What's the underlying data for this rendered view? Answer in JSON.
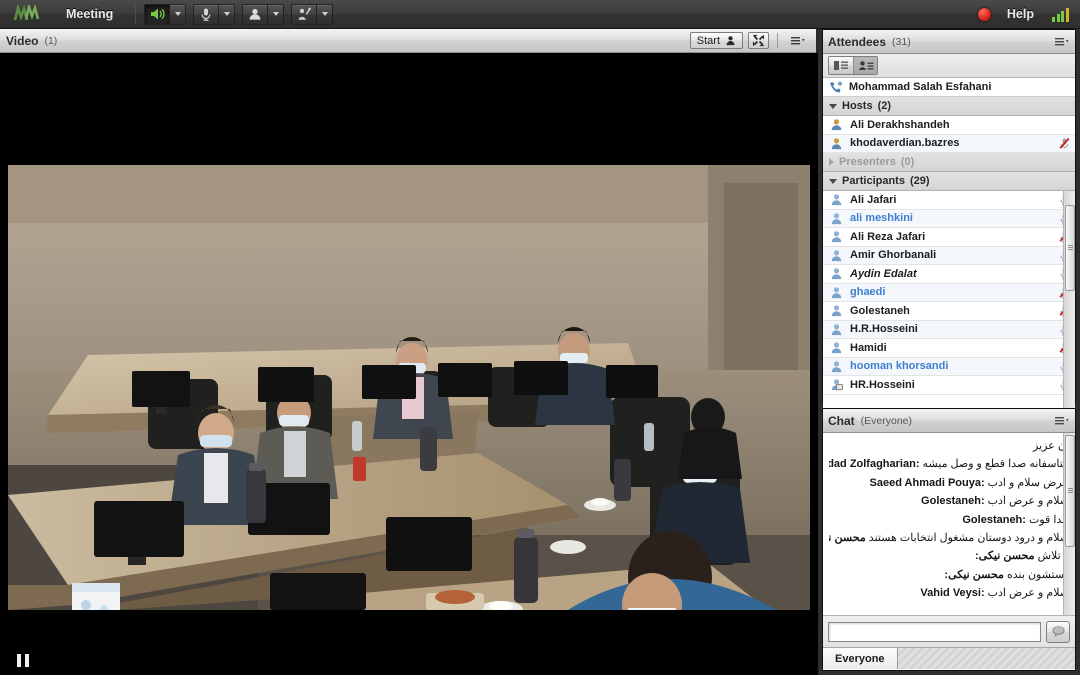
{
  "topbar": {
    "logo": "M",
    "menu_label": "Meeting",
    "controls": [
      {
        "name": "speaker",
        "icon": "speaker-icon",
        "active": true
      },
      {
        "name": "microphone",
        "icon": "microphone-icon",
        "active": false
      },
      {
        "name": "camera",
        "icon": "camera-icon",
        "active": false
      },
      {
        "name": "raise-hand",
        "icon": "raise-hand-icon",
        "active": false
      }
    ],
    "record_label": "",
    "help_label": "Help",
    "signal_icon": "signal-strength-icon"
  },
  "video_pod": {
    "title": "Video",
    "count": "(1)",
    "start_label": "Start",
    "start_icon": "person-icon",
    "fullscreen_icon": "fullscreen-icon",
    "menu_icon": "pod-menu-icon",
    "pause_icon": "pause-icon"
  },
  "attendees": {
    "title": "Attendees",
    "count": "(31)",
    "menu_icon": "panel-menu-icon",
    "view_buttons": [
      {
        "name": "list-view-button",
        "icon": "list-view-icon",
        "selected": false
      },
      {
        "name": "card-view-button",
        "icon": "card-view-icon",
        "selected": true
      }
    ],
    "self": {
      "name": "Mohammad Salah Esfahani",
      "icon": "phone-attendee-icon"
    },
    "groups": [
      {
        "label": "Hosts",
        "count": "(2)",
        "expanded": true
      },
      {
        "label": "Presenters",
        "count": "(0)",
        "expanded": false
      },
      {
        "label": "Participants",
        "count": "(29)",
        "expanded": true
      }
    ],
    "hosts": [
      {
        "name": "Ali Derakhshandeh",
        "icon": "host-icon",
        "mic": "none",
        "highlight": false
      },
      {
        "name": "khodaverdian.bazres",
        "icon": "host-icon",
        "mic": "muted",
        "highlight": false
      }
    ],
    "participants": [
      {
        "name": "Ali Jafari",
        "icon": "attendee-icon",
        "mic": "on",
        "highlight": false,
        "italic": false
      },
      {
        "name": "ali meshkini",
        "icon": "attendee-icon",
        "mic": "on",
        "highlight": true,
        "italic": false
      },
      {
        "name": "Ali Reza Jafari",
        "icon": "attendee-icon",
        "mic": "muted",
        "highlight": false,
        "italic": false
      },
      {
        "name": "Amir Ghorbanali",
        "icon": "attendee-icon",
        "mic": "on",
        "highlight": false,
        "italic": false
      },
      {
        "name": "Aydin Edalat",
        "icon": "attendee-icon",
        "mic": "on",
        "highlight": false,
        "italic": true
      },
      {
        "name": "ghaedi",
        "icon": "attendee-icon",
        "mic": "muted",
        "highlight": true,
        "italic": false
      },
      {
        "name": "Golestaneh",
        "icon": "attendee-icon",
        "mic": "muted",
        "highlight": false,
        "italic": false
      },
      {
        "name": "H.R.Hosseini",
        "icon": "attendee-icon",
        "mic": "on",
        "highlight": false,
        "italic": false
      },
      {
        "name": "Hamidi",
        "icon": "attendee-icon",
        "mic": "muted",
        "highlight": false,
        "italic": false
      },
      {
        "name": "hooman khorsandi",
        "icon": "attendee-icon",
        "mic": "on",
        "highlight": true,
        "italic": false
      },
      {
        "name": "HR.Hosseini",
        "icon": "attendee-presenting-icon",
        "mic": "on",
        "highlight": false,
        "italic": false
      }
    ]
  },
  "chat": {
    "title": "Chat",
    "scope": "(Everyone)",
    "menu_icon": "panel-menu-icon",
    "messages": [
      {
        "sender": "",
        "sender_dir": "rtl",
        "text": "ان عزیز"
      },
      {
        "sender": "Mehrdad Zolfagharian:",
        "sender_dir": "ltr",
        "text": "متاسفانه صدا قطع و وصل میشه"
      },
      {
        "sender": "Saeed Ahmadi Pouya:",
        "sender_dir": "ltr",
        "text": "عرض سلام و ادب"
      },
      {
        "sender": "Golestaneh:",
        "sender_dir": "ltr",
        "text": "سلام و عرض ادب"
      },
      {
        "sender": "Golestaneh:",
        "sender_dir": "ltr",
        "text": "خدا قوت"
      },
      {
        "sender": "محسن نیکی:",
        "sender_dir": "rtl",
        "text": "سلام و درود  دوستان مشغول انتخابات هستند"
      },
      {
        "sender": "محسن نیکی:",
        "sender_dir": "rtl",
        "text": "و تلاش"
      },
      {
        "sender": "محسن نیکی:",
        "sender_dir": "rtl",
        "text": "دستشون بنده"
      },
      {
        "sender": "Vahid Veysi:",
        "sender_dir": "ltr",
        "text": "سلام و عرض ادب"
      }
    ],
    "input_value": "",
    "input_placeholder": "",
    "send_icon": "send-message-icon",
    "tabs": [
      {
        "label": "Everyone",
        "active": true
      }
    ]
  },
  "colors": {
    "chrome_dark": "#333333",
    "panel_header": "#d6d6d6",
    "highlight_name": "#3f7fd0",
    "mic_muted": "#cc2222",
    "record": "#cc1b12",
    "speaker_active": "#7ac943"
  }
}
